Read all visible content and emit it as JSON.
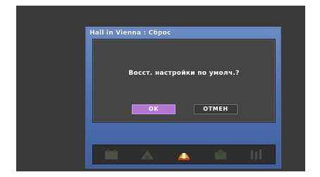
{
  "window": {
    "title": "Hall in Vienna : Сброс"
  },
  "dialog": {
    "message": "Восст. настройки по умолч.?",
    "ok_label": "OK",
    "cancel_label": "ОТМЕН"
  },
  "preset_bar": {
    "icons": [
      "preset-1-icon",
      "preset-2-icon",
      "preset-hall-icon",
      "preset-4-icon",
      "preset-5-icon"
    ],
    "active_index": 2
  },
  "colors": {
    "frame_blue": "#5273b1",
    "dialog_gray": "#454545",
    "ok_highlight": "#b078d4"
  }
}
